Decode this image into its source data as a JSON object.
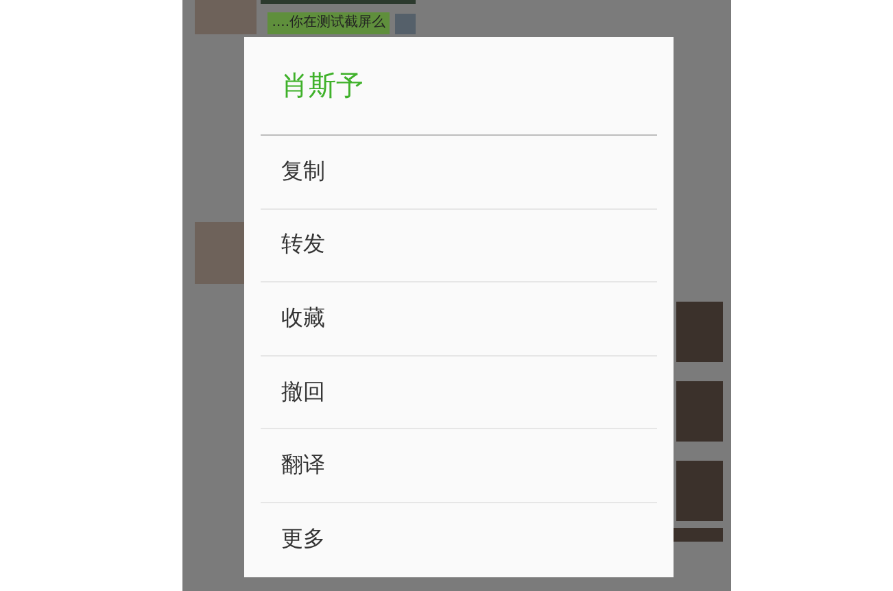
{
  "chat": {
    "messages": [
      {
        "outgoing": true,
        "text": "....你在测试截屏么"
      }
    ]
  },
  "menu": {
    "title": "肖斯予",
    "items": [
      {
        "label": "复制"
      },
      {
        "label": "转发"
      },
      {
        "label": "收藏"
      },
      {
        "label": "撤回"
      },
      {
        "label": "翻译"
      },
      {
        "label": "更多"
      }
    ]
  }
}
